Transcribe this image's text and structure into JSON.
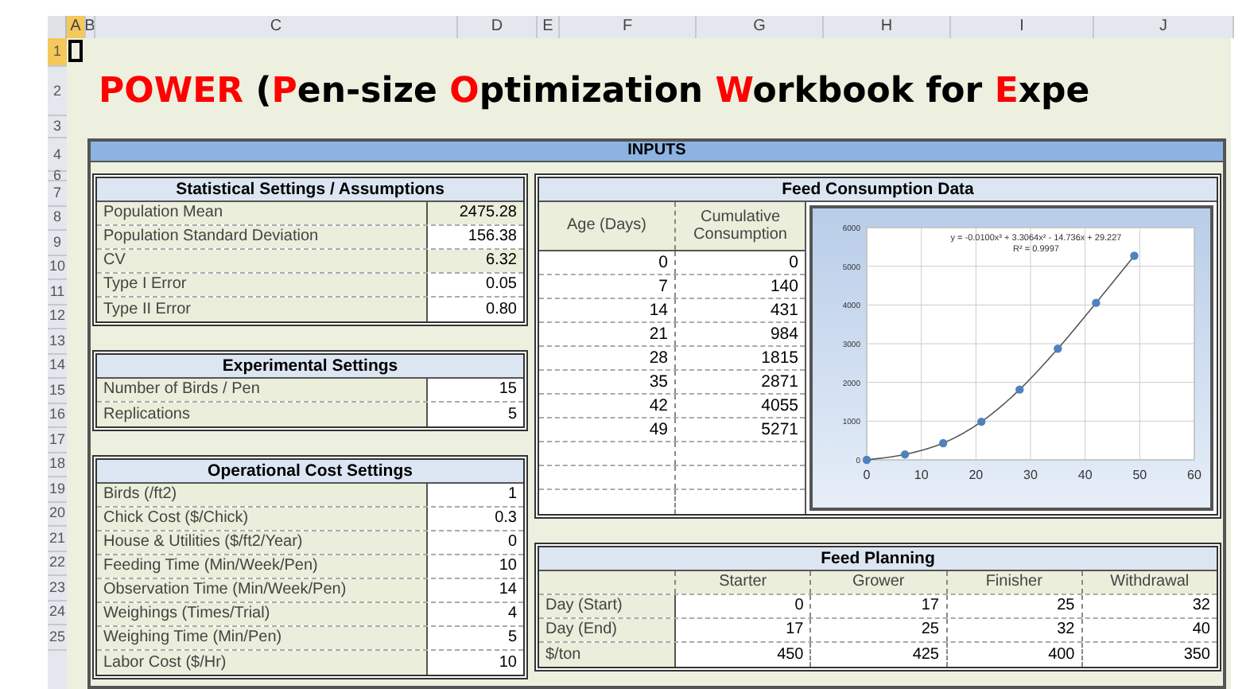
{
  "column_headers": [
    {
      "label": "A",
      "selected": true
    },
    {
      "label": "B",
      "selected": false
    },
    {
      "label": "C",
      "selected": false
    },
    {
      "label": "D",
      "selected": false
    },
    {
      "label": "E",
      "selected": false
    },
    {
      "label": "F",
      "selected": false
    },
    {
      "label": "G",
      "selected": false
    },
    {
      "label": "H",
      "selected": false
    },
    {
      "label": "I",
      "selected": false
    },
    {
      "label": "J",
      "selected": false
    }
  ],
  "row_numbers": [
    {
      "label": "1",
      "selected": true
    },
    {
      "label": "2",
      "selected": false
    },
    {
      "label": "3",
      "selected": false
    },
    {
      "label": "4",
      "selected": false
    },
    {
      "label": "6",
      "selected": false
    },
    {
      "label": "7",
      "selected": false
    },
    {
      "label": "8",
      "selected": false
    },
    {
      "label": "9",
      "selected": false
    },
    {
      "label": "10",
      "selected": false
    },
    {
      "label": "11",
      "selected": false
    },
    {
      "label": "12",
      "selected": false
    },
    {
      "label": "13",
      "selected": false
    },
    {
      "label": "14",
      "selected": false
    },
    {
      "label": "15",
      "selected": false
    },
    {
      "label": "16",
      "selected": false
    },
    {
      "label": "17",
      "selected": false
    },
    {
      "label": "18",
      "selected": false
    },
    {
      "label": "19",
      "selected": false
    },
    {
      "label": "20",
      "selected": false
    },
    {
      "label": "21",
      "selected": false
    },
    {
      "label": "22",
      "selected": false
    },
    {
      "label": "23",
      "selected": false
    },
    {
      "label": "24",
      "selected": false
    },
    {
      "label": "25",
      "selected": false
    }
  ],
  "title": [
    {
      "text": "POWER",
      "highlight": true
    },
    {
      "text": " (",
      "highlight": false
    },
    {
      "text": "P",
      "highlight": true
    },
    {
      "text": "en-size ",
      "highlight": false
    },
    {
      "text": "O",
      "highlight": true
    },
    {
      "text": "ptimization ",
      "highlight": false
    },
    {
      "text": "W",
      "highlight": true
    },
    {
      "text": "orkbook for ",
      "highlight": false
    },
    {
      "text": "E",
      "highlight": true
    },
    {
      "text": "xpe",
      "highlight": false
    }
  ],
  "inputs_bar": "INPUTS",
  "statistical": {
    "title": "Statistical Settings / Assumptions",
    "rows": [
      {
        "label": "Population Mean",
        "value": "2475.28",
        "kind": "computed"
      },
      {
        "label": "Population Standard Deviation",
        "value": "156.38",
        "kind": "input"
      },
      {
        "label": "CV",
        "value": "6.32",
        "kind": "computed"
      },
      {
        "label": "Type I Error",
        "value": "0.05",
        "kind": "input"
      },
      {
        "label": "Type II Error",
        "value": "0.80",
        "kind": "input"
      }
    ]
  },
  "experimental": {
    "title": "Experimental Settings",
    "rows": [
      {
        "label": "Number of Birds / Pen",
        "value": "15"
      },
      {
        "label": "Replications",
        "value": "5"
      }
    ]
  },
  "operational": {
    "title": "Operational Cost Settings",
    "rows": [
      {
        "label": "Birds (/ft2)",
        "value": "1"
      },
      {
        "label": "Chick Cost ($/Chick)",
        "value": "0.3"
      },
      {
        "label": "House & Utilities ($/ft2/Year)",
        "value": "0"
      },
      {
        "label": "Feeding Time (Min/Week/Pen)",
        "value": "10"
      },
      {
        "label": "Observation Time (Min/Week/Pen)",
        "value": "14"
      },
      {
        "label": "Weighings (Times/Trial)",
        "value": "4"
      },
      {
        "label": "Weighing Time (Min/Pen)",
        "value": "5"
      },
      {
        "label": "Labor Cost ($/Hr)",
        "value": "10"
      }
    ]
  },
  "feed_consumption": {
    "title": "Feed Consumption Data",
    "columns": [
      "Age (Days)",
      "Cumulative Consumption"
    ],
    "rows": [
      [
        "0",
        "0"
      ],
      [
        "7",
        "140"
      ],
      [
        "14",
        "431"
      ],
      [
        "21",
        "984"
      ],
      [
        "28",
        "1815"
      ],
      [
        "35",
        "2871"
      ],
      [
        "42",
        "4055"
      ],
      [
        "49",
        "5271"
      ]
    ],
    "chart_data": {
      "type": "scatter",
      "x": [
        0,
        7,
        14,
        21,
        28,
        35,
        42,
        49
      ],
      "series": [
        {
          "type": "scatter",
          "color": "#4f81bd",
          "values": [
            0,
            140,
            431,
            984,
            1815,
            2871,
            4055,
            5271
          ]
        },
        {
          "type": "line",
          "color": "#555555",
          "values": [
            0,
            140,
            431,
            984,
            1815,
            2871,
            4055,
            5271
          ]
        }
      ],
      "grid": true,
      "xlim": [
        0,
        60
      ],
      "ylim": [
        0,
        6000
      ],
      "xticks": [
        0,
        10,
        20,
        30,
        40,
        50,
        60
      ],
      "yticks": [
        0,
        1000,
        2000,
        3000,
        4000,
        5000,
        6000
      ],
      "annotations": [
        "y = -0.0100x³ + 3.3064x² - 14.736x + 29.227",
        "R² = 0.9997"
      ]
    }
  },
  "feed_planning": {
    "title": "Feed Planning",
    "columns": [
      "Starter",
      "Grower",
      "Finisher",
      "Withdrawal"
    ],
    "rows": [
      {
        "label": "Day (Start)",
        "values": [
          "0",
          "17",
          "25",
          "32"
        ]
      },
      {
        "label": "Day (End)",
        "values": [
          "17",
          "25",
          "32",
          "40"
        ]
      },
      {
        "label": "$/ton",
        "values": [
          "450",
          "425",
          "400",
          "350"
        ]
      }
    ]
  }
}
